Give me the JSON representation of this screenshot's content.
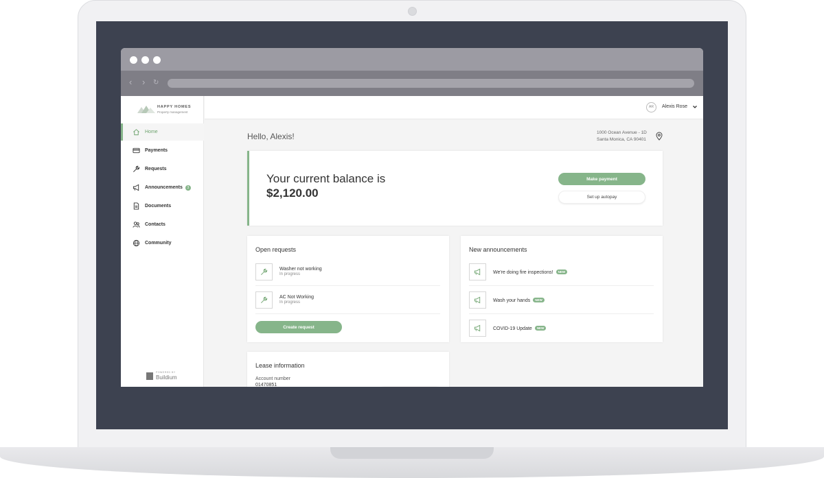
{
  "brand": {
    "name": "HAPPY HOMES",
    "tagline": "Property management",
    "accent_color": "#86b58a"
  },
  "sidebar": {
    "items": [
      {
        "label": "Home",
        "icon": "home-icon",
        "active": true
      },
      {
        "label": "Payments",
        "icon": "credit-card-icon"
      },
      {
        "label": "Requests",
        "icon": "wrench-icon"
      },
      {
        "label": "Announcements",
        "icon": "megaphone-icon",
        "badge": "3"
      },
      {
        "label": "Documents",
        "icon": "document-icon"
      },
      {
        "label": "Contacts",
        "icon": "people-icon"
      },
      {
        "label": "Community",
        "icon": "globe-icon"
      }
    ],
    "powered_by_label": "POWERED BY",
    "powered_by_name": "Buildium"
  },
  "header": {
    "user_initials": "AR",
    "user_name": "Alexis Rose"
  },
  "main": {
    "greeting": "Hello, Alexis!",
    "address_line1": "1000 Ocean Avenue - 1D",
    "address_line2": "Santa Monica, CA 90401",
    "balance": {
      "title": "Your current balance is",
      "amount": "$2,120.00",
      "pay_button": "Make payment",
      "autopay_button": "Set up autopay"
    },
    "open_requests": {
      "title": "Open requests",
      "items": [
        {
          "title": "Washer not working",
          "status": "In progress"
        },
        {
          "title": "AC Not Working",
          "status": "In progress"
        }
      ],
      "create_button": "Create request"
    },
    "announcements": {
      "title": "New announcements",
      "badge_label": "NEW",
      "items": [
        {
          "title": "We're doing fire inspections!"
        },
        {
          "title": "Wash your hands"
        },
        {
          "title": "COVID-19 Update"
        }
      ]
    },
    "lease": {
      "title": "Lease information",
      "account_label": "Account number",
      "account_value": "01470851"
    }
  }
}
